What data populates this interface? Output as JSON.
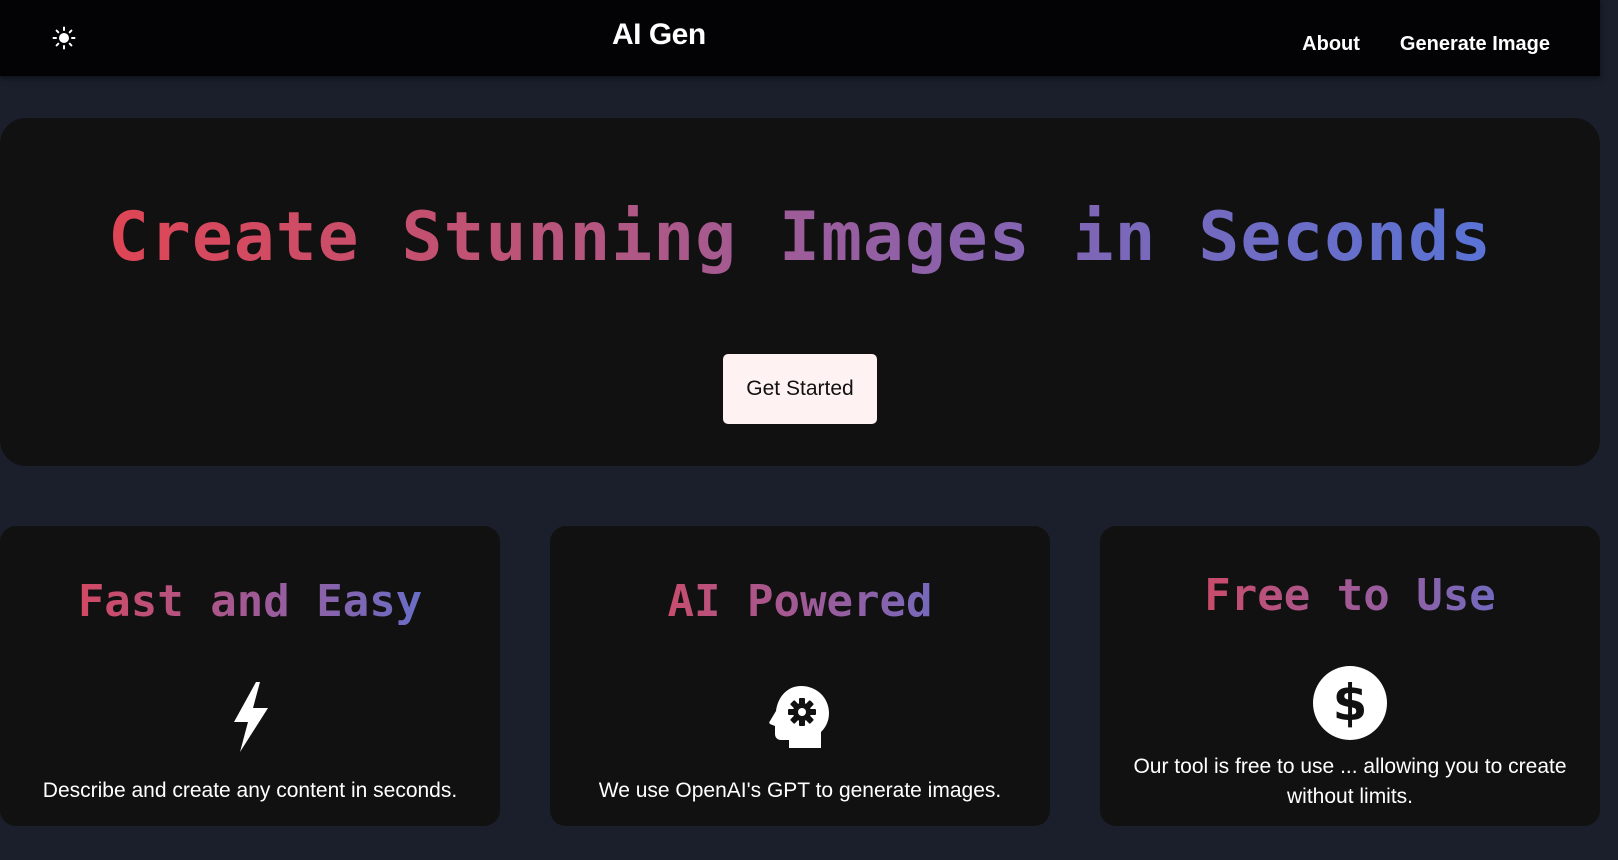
{
  "header": {
    "theme_icon": "sun-icon",
    "brand": "AI Gen",
    "nav": [
      {
        "label": "About"
      },
      {
        "label": "Generate Image"
      }
    ]
  },
  "hero": {
    "title": "Create Stunning Images in Seconds",
    "cta_label": "Get Started"
  },
  "features": [
    {
      "title": "Fast and Easy",
      "icon": "lightning-bolt-icon",
      "text": "Describe and create any content in seconds."
    },
    {
      "title": "AI Powered",
      "icon": "head-gear-icon",
      "text": "We use OpenAI's GPT to generate images."
    },
    {
      "title": "Free to Use",
      "icon": "dollar-circle-icon",
      "text": "Our tool is free to use ... allowing you to create without limits."
    }
  ],
  "colors": {
    "page_background": "#1a1f2b",
    "panel_background": "#111111",
    "navbar_background": "#030305",
    "gradient_start": "#e8424c",
    "gradient_end": "#4f77dd",
    "cta_background": "#fff2f2"
  }
}
